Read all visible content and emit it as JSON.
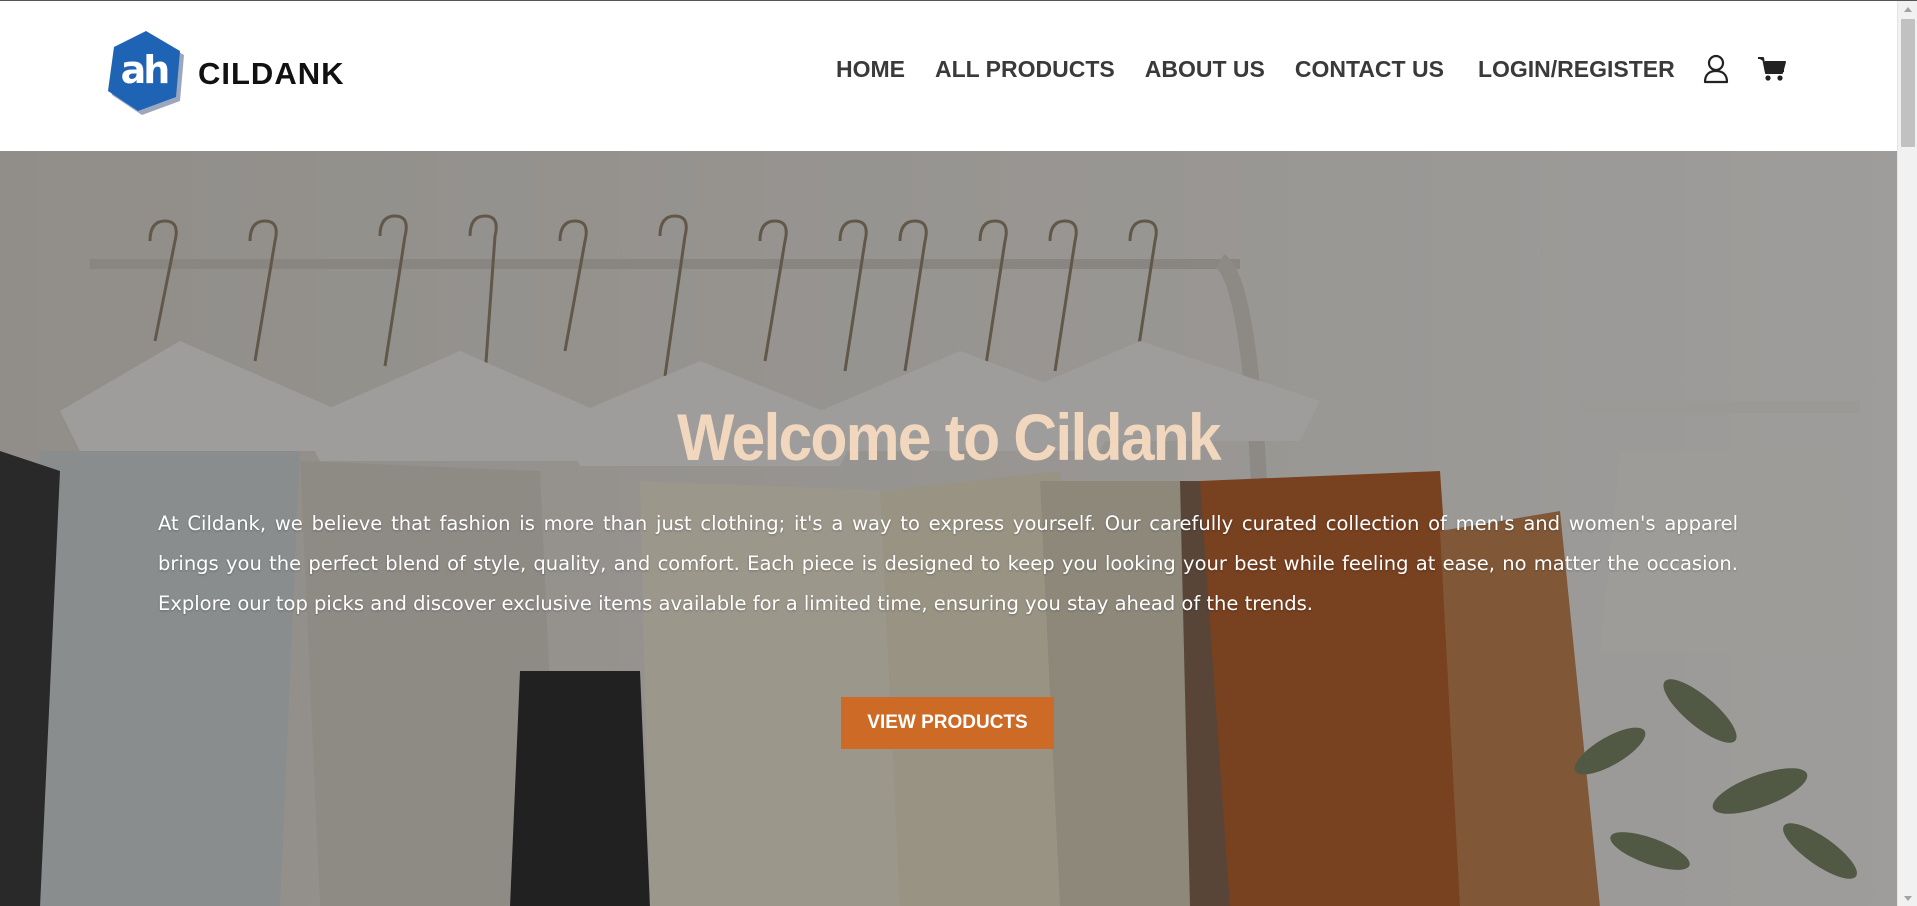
{
  "brand": {
    "name": "CILDANK",
    "logo_mark_text": "ah",
    "logo_color": "#1f63b5"
  },
  "nav": {
    "home": "HOME",
    "all_products": "ALL PRODUCTS",
    "about_us": "ABOUT US",
    "contact_us": "CONTACT US",
    "login_register": "LOGIN/REGISTER",
    "user_icon": "user-icon",
    "cart_icon": "cart-icon"
  },
  "hero": {
    "title": "Welcome to Cildank",
    "description": "At Cildank, we believe that fashion is more than just clothing; it's a way to express yourself. Our carefully curated collection of men's and women's apparel brings you the perfect blend of style, quality, and comfort. Each piece is designed to keep you looking your best while feeling at ease, no matter the occasion. Explore our top picks and discover exclusive items available for a limited time, ensuring you stay ahead of the trends.",
    "button_label": "VIEW PRODUCTS",
    "title_color": "#f1d7bd",
    "button_color": "#cc6a26"
  }
}
